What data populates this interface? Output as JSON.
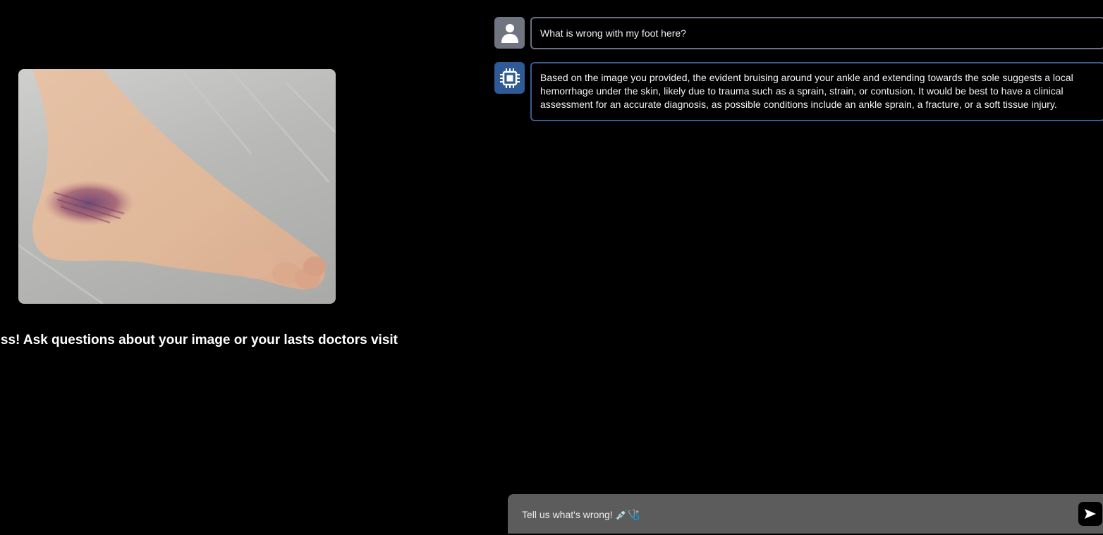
{
  "left": {
    "caption": "ss! Ask questions about your image or your lasts doctors visit"
  },
  "messages": [
    {
      "role": "user",
      "icon": "user-icon",
      "text": "What is wrong with my foot here?"
    },
    {
      "role": "assistant",
      "icon": "chip-icon",
      "text": "Based on the image you provided, the evident bruising around your ankle and extending towards the sole suggests a local hemorrhage under the skin, likely due to trauma such as a sprain, strain, or contusion. It would be best to have a clinical assessment for an accurate diagnosis, as possible conditions include an ankle sprain, a fracture, or a soft tissue injury."
    }
  ],
  "input": {
    "placeholder": "Tell us what's wrong! 💉🩺",
    "send_icon": "send-icon"
  },
  "colors": {
    "background": "#000000",
    "user_avatar": "#6f7480",
    "bot_avatar": "#2f5a96",
    "input_bar": "#5c5c5c"
  }
}
